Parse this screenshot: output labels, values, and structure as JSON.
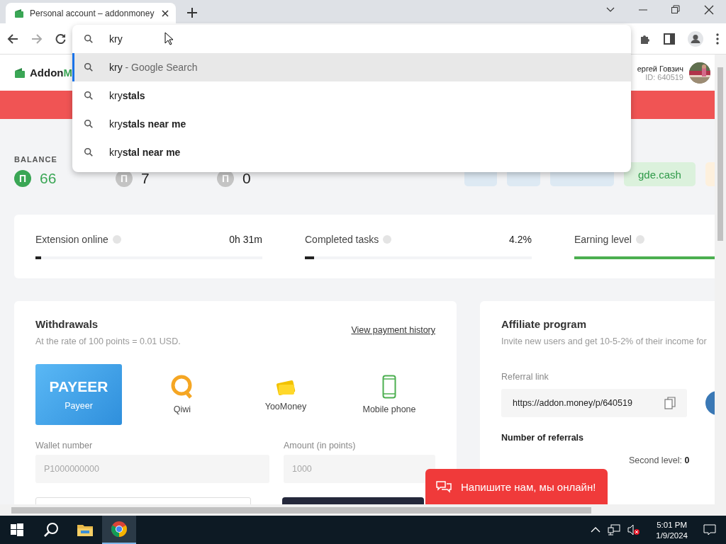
{
  "browser": {
    "tab": {
      "title": "Personal account – addonmoney"
    },
    "omnibox": {
      "value": "kry"
    },
    "suggestions": [
      {
        "kind": "engine",
        "text": "kry",
        "hint": "- Google Search",
        "selected": true
      },
      {
        "kind": "completion",
        "text": "kry**stals**",
        "selected": false
      },
      {
        "kind": "completion",
        "text": "kry**stals near me**",
        "selected": false
      },
      {
        "kind": "completion",
        "text": "kry**stal near me**",
        "selected": false
      }
    ]
  },
  "site": {
    "logo": {
      "main": "Addon",
      "accent": "M"
    },
    "user": {
      "name": "ергей Говзич",
      "id": "ID: 640519"
    }
  },
  "balance": {
    "label": "BALANCE",
    "items": [
      {
        "symbol": "П",
        "value": "66",
        "color": "#3aa655"
      },
      {
        "symbol": "П",
        "value": "7",
        "color": "#c4c4c4"
      },
      {
        "symbol": "П",
        "value": "0",
        "color": "#c4c4c4"
      }
    ],
    "action": "gde.cash"
  },
  "stats": [
    {
      "label": "Extension online",
      "value": "0h 31m",
      "level": 0.02,
      "color": "#222222"
    },
    {
      "label": "Completed tasks",
      "value": "4.2%",
      "level": 0.04,
      "color": "#222222"
    },
    {
      "label": "Earning level",
      "level": 1,
      "color": "#4caf50"
    }
  ],
  "withdrawals": {
    "title": "Withdrawals",
    "subtitle": "At the rate of 100 points = 0.01 USD.",
    "history_link": "View payment history",
    "methods": [
      {
        "kind": "payeer",
        "logo": "PAYEER",
        "label": "Payeer",
        "selected": true
      },
      {
        "kind": "qiwi",
        "label": "Qiwi",
        "selected": false
      },
      {
        "kind": "yoomoney",
        "label": "YooMoney",
        "selected": false
      },
      {
        "kind": "phone",
        "label": "Mobile phone",
        "selected": false
      }
    ],
    "fields": [
      {
        "label": "Wallet number",
        "placeholder": "P1000000000"
      },
      {
        "label": "Amount (in points)",
        "placeholder": "1000"
      }
    ]
  },
  "affiliate": {
    "title": "Affiliate program",
    "subtitle": "Invite new users and get 10-5-2% of their income for",
    "link_label": "Referral link",
    "link": "https://addon.money/p/640519",
    "referrals_title": "Number of referrals",
    "second_level": {
      "label": "Second level:",
      "value": "0"
    }
  },
  "chat": {
    "label": "Напишите нам, мы онлайн!"
  },
  "taskbar": {
    "apps": [
      {
        "kind": "search",
        "active": false
      },
      {
        "kind": "folder",
        "active": false
      },
      {
        "kind": "chrome",
        "active": true
      }
    ],
    "clock": {
      "time": "5:01 PM",
      "date": "1/9/2024"
    }
  }
}
